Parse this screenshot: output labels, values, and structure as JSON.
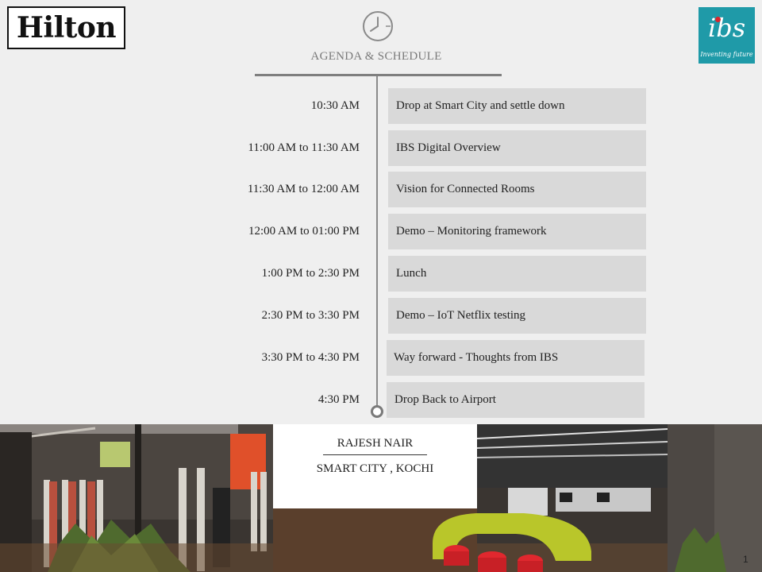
{
  "logos": {
    "hilton": "Hilton",
    "ibs": {
      "mark": "ibs",
      "tagline": "Inventing future"
    }
  },
  "header": {
    "icon": "clock-icon",
    "title": "AGENDA & SCHEDULE"
  },
  "agenda": [
    {
      "time": "10:30 AM",
      "activity": "Drop at Smart City and settle down"
    },
    {
      "time": "11:00 AM to 11:30 AM",
      "activity": "IBS Digital Overview"
    },
    {
      "time": "11:30 AM to 12:00 AM",
      "activity": "Vision for Connected Rooms"
    },
    {
      "time": "12:00 AM to 01:00 PM",
      "activity": "Demo – Monitoring framework"
    },
    {
      "time": "1:00 PM to 2:30 PM",
      "activity": "Lunch"
    },
    {
      "time": "2:30 PM to 3:30 PM",
      "activity": "Demo – IoT Netflix testing"
    },
    {
      "time": "3:30 PM to 4:30 PM",
      "activity": "Way forward - Thoughts from IBS"
    },
    {
      "time": "4:30 PM",
      "activity": "Drop Back to Airport"
    }
  ],
  "presenter": {
    "name": "RAJESH NAIR",
    "location": "SMART CITY , KOCHI"
  },
  "page_number": "1",
  "colors": {
    "background": "#efefef",
    "agenda_box": "#d9d9d9",
    "timeline": "#8a8a8a",
    "ibs_brand": "#1f9aa8",
    "ibs_dot": "#d8262e",
    "title_text": "#7a7a7a"
  }
}
